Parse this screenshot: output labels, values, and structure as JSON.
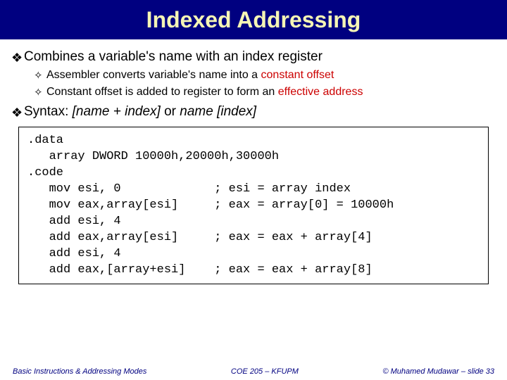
{
  "title": "Indexed Addressing",
  "bullets": [
    {
      "text": "Combines a variable's name with an index register",
      "subs": [
        {
          "pre": "Assembler converts variable's name into a ",
          "em": "constant offset"
        },
        {
          "pre": "Constant offset is added to register to form an ",
          "em": "effective address"
        }
      ]
    }
  ],
  "syntax": {
    "label": "Syntax: ",
    "part1": "[name + index]",
    "mid": " or ",
    "part2": "name",
    "part3": "[index]"
  },
  "code": ".data\n   array DWORD 10000h,20000h,30000h\n.code\n   mov esi, 0             ; esi = array index\n   mov eax,array[esi]     ; eax = array[0] = 10000h\n   add esi, 4\n   add eax,array[esi]     ; eax = eax + array[4]\n   add esi, 4\n   add eax,[array+esi]    ; eax = eax + array[8]",
  "footer": {
    "left": "Basic Instructions & Addressing Modes",
    "center": "COE 205 – KFUPM",
    "right": "© Muhamed Mudawar – slide 33"
  }
}
